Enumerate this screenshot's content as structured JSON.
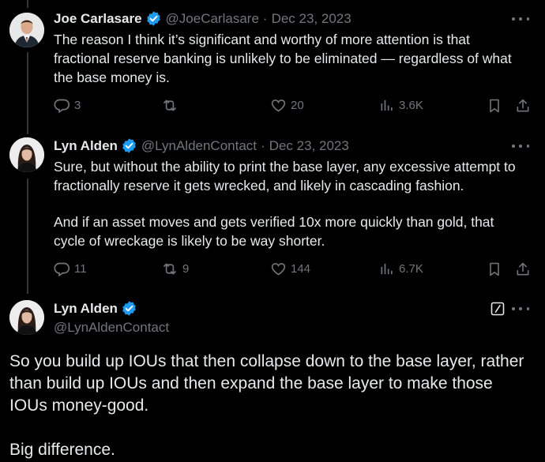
{
  "tweets": [
    {
      "name": "Joe Carlasare",
      "handle": "@JoeCarlasare",
      "date": "Dec 23, 2023",
      "paragraphs": [
        "The reason I think it’s significant and worthy of more attention is that fractional reserve banking is unlikely to be eliminated — regardless of what the base money is."
      ],
      "replies": "3",
      "reposts": "",
      "likes": "20",
      "views": "3.6K"
    },
    {
      "name": "Lyn Alden",
      "handle": "@LynAldenContact",
      "date": "Dec 23, 2023",
      "paragraphs": [
        "Sure, but without the ability to print the base layer, any excessive attempt to fractionally reserve it gets wrecked, and likely in cascading fashion.",
        "And if an asset moves and gets verified 10x more quickly than gold, that cycle of wreckage is likely to be way shorter."
      ],
      "replies": "11",
      "reposts": "9",
      "likes": "144",
      "views": "6.7K"
    }
  ],
  "main_tweet": {
    "name": "Lyn Alden",
    "handle": "@LynAldenContact",
    "paragraphs": [
      "So you build up IOUs that then collapse down to the base layer, rather than build up IOUs and then expand the base layer to make those IOUs money-good.",
      "Big difference."
    ]
  },
  "colors": {
    "background": "#000000",
    "text": "#e7e9ea",
    "secondary": "#71767b",
    "verified": "#1d9bf0",
    "thread_line": "#333639"
  },
  "icons": [
    "reply-icon",
    "repost-icon",
    "like-icon",
    "views-icon",
    "bookmark-icon",
    "share-icon",
    "more-icon",
    "verified-badge-icon",
    "edit-icon"
  ]
}
